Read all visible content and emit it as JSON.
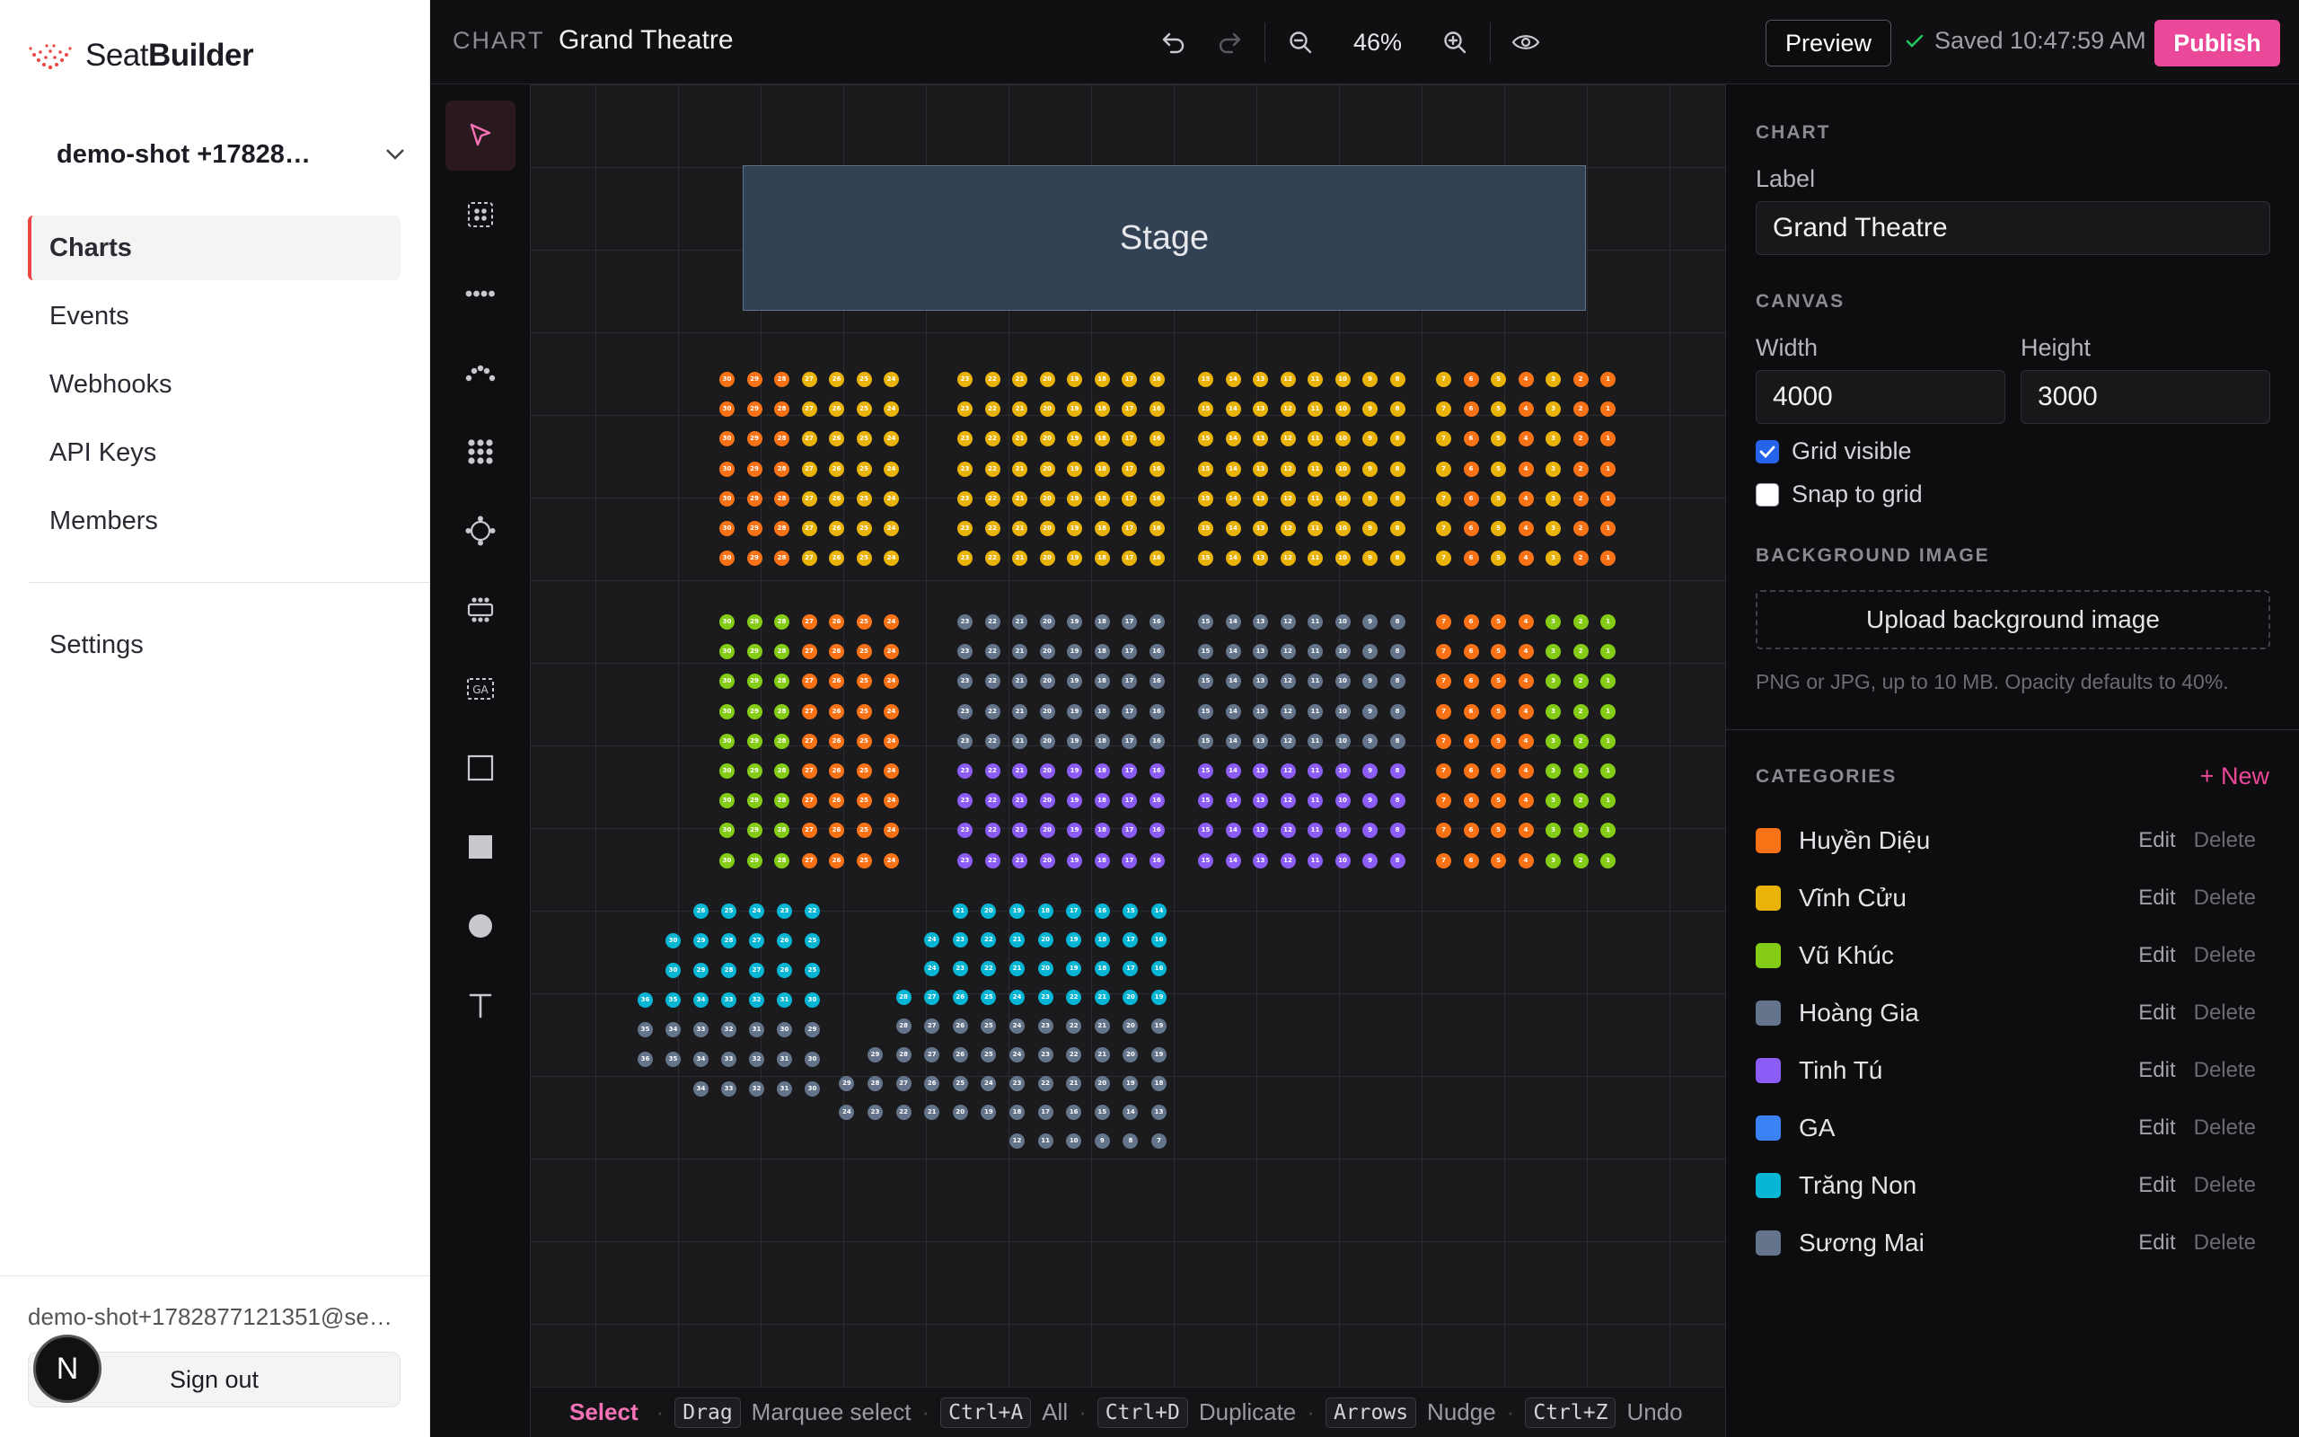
{
  "brand": {
    "name_light": "Seat",
    "name_bold": "Builder"
  },
  "org": {
    "name": "demo-shot +17828…"
  },
  "nav": [
    {
      "label": "Charts",
      "active": true
    },
    {
      "label": "Events"
    },
    {
      "label": "Webhooks"
    },
    {
      "label": "API Keys"
    },
    {
      "label": "Members"
    }
  ],
  "nav_settings": "Settings",
  "account": {
    "email": "demo-shot+1782877121351@seat…",
    "signout": "Sign out",
    "avatar_letter": "N"
  },
  "topbar": {
    "crumb": "CHART",
    "title": "Grand Theatre",
    "zoom": "46%",
    "preview": "Preview",
    "saved": "Saved 10:47:59 AM",
    "publish": "Publish"
  },
  "tools": [
    "select-tool",
    "section-tool",
    "row-tool",
    "curved-row-tool",
    "grid-tool",
    "round-table-tool",
    "rect-table-tool",
    "ga-area-tool",
    "rectangle-tool",
    "filled-rectangle-tool",
    "circle-tool",
    "text-tool"
  ],
  "canvas": {
    "stage_label": "Stage"
  },
  "shortcuts": {
    "mode": "Select",
    "items": [
      {
        "key": "Drag",
        "desc": "Marquee select"
      },
      {
        "key": "Ctrl+A",
        "desc": "All"
      },
      {
        "key": "Ctrl+D",
        "desc": "Duplicate"
      },
      {
        "key": "Arrows",
        "desc": "Nudge"
      },
      {
        "key": "Ctrl+Z",
        "desc": "Undo"
      }
    ]
  },
  "inspector": {
    "chart_section": "CHART",
    "label_field": "Label",
    "label_value": "Grand Theatre",
    "canvas_section": "CANVAS",
    "width_label": "Width",
    "width_value": "4000",
    "height_label": "Height",
    "height_value": "3000",
    "grid_visible_label": "Grid visible",
    "grid_visible": true,
    "snap_label": "Snap to grid",
    "snap": false,
    "bg_section": "BACKGROUND IMAGE",
    "upload_label": "Upload background image",
    "upload_hint": "PNG or JPG, up to 10 MB. Opacity defaults to 40%.",
    "categories_section": "CATEGORIES",
    "new_label": "+ New",
    "edit_label": "Edit",
    "delete_label": "Delete"
  },
  "categories": [
    {
      "name": "Huyền Diệu",
      "color": "#f97316"
    },
    {
      "name": "Vĩnh Cửu",
      "color": "#eab308"
    },
    {
      "name": "Vũ Khúc",
      "color": "#84cc16"
    },
    {
      "name": "Hoàng Gia",
      "color": "#64748b"
    },
    {
      "name": "Tinh Tú",
      "color": "#8b5cf6"
    },
    {
      "name": "GA",
      "color": "#3b82f6"
    },
    {
      "name": "Trăng Non",
      "color": "#06b6d4"
    },
    {
      "name": "Sương Mai",
      "color": "#64748b"
    }
  ],
  "seat_blocks": [
    {
      "name": "block-a-top",
      "cols": [
        30,
        29,
        28,
        27,
        26,
        25,
        24
      ],
      "rows": 7,
      "colors": [
        "#f97316",
        "#f97316",
        "#f97316",
        "#eab308",
        "#eab308",
        "#eab308",
        "#eab308"
      ]
    },
    {
      "name": "block-b-top",
      "cols": [
        23,
        22,
        21,
        20,
        19,
        18,
        17,
        16
      ],
      "rows": 7,
      "colors": [
        "#eab308"
      ]
    },
    {
      "name": "block-c-top",
      "cols": [
        15,
        14,
        13,
        12,
        11,
        10,
        9,
        8
      ],
      "rows": 7,
      "colors": [
        "#eab308"
      ]
    },
    {
      "name": "block-d-top",
      "cols": [
        7,
        6,
        5,
        4,
        3,
        2,
        1
      ],
      "rows": 7,
      "colors": [
        "#eab308",
        "#f97316",
        "#eab308",
        "#f97316",
        "#eab308",
        "#f97316",
        "#f97316"
      ]
    },
    {
      "name": "block-a-mid",
      "cols": [
        30,
        29,
        28,
        27,
        26,
        25,
        24
      ],
      "rows": 9,
      "colors": [
        "#84cc16",
        "#84cc16",
        "#84cc16",
        "#f97316",
        "#f97316",
        "#f97316",
        "#f97316"
      ]
    },
    {
      "name": "block-b-mid",
      "cols": [
        23,
        22,
        21,
        20,
        19,
        18,
        17,
        16
      ],
      "rows": 9,
      "colors": [
        "#64748b"
      ],
      "accent_rows_from": 5,
      "accent": "#8b5cf6"
    },
    {
      "name": "block-c-mid",
      "cols": [
        15,
        14,
        13,
        12,
        11,
        10,
        9,
        8
      ],
      "rows": 9,
      "colors": [
        "#64748b"
      ],
      "accent_rows_from": 5,
      "accent": "#8b5cf6"
    },
    {
      "name": "block-d-mid",
      "cols": [
        7,
        6,
        5,
        4,
        3,
        2,
        1
      ],
      "rows": 9,
      "colors": [
        "#f97316",
        "#f97316",
        "#f97316",
        "#f97316",
        "#84cc16",
        "#84cc16",
        "#84cc16"
      ]
    }
  ],
  "balcony_rows": [
    {
      "labels": [
        26,
        25,
        24,
        23,
        22
      ],
      "color": "#06b6d4"
    },
    {
      "labels": [
        30,
        29,
        28,
        27,
        26,
        25
      ],
      "color": "#06b6d4"
    },
    {
      "labels": [
        30,
        29,
        28,
        27,
        26,
        25
      ],
      "color": "#06b6d4"
    },
    {
      "labels": [
        36,
        35,
        34,
        33,
        32,
        31,
        30
      ],
      "color": "#06b6d4"
    },
    {
      "labels": [
        35,
        34,
        33,
        32,
        31,
        30,
        29
      ],
      "color": "#64748b"
    },
    {
      "labels": [
        36,
        35,
        34,
        33,
        32,
        31,
        30
      ],
      "color": "#64748b"
    },
    {
      "labels": [
        34,
        33,
        32,
        31,
        30
      ],
      "color": "#64748b"
    }
  ],
  "balcony_right_rows": [
    {
      "labels": [
        21,
        20,
        19,
        18,
        17,
        16,
        15,
        14
      ],
      "color": "#06b6d4"
    },
    {
      "labels": [
        24,
        23,
        22,
        21,
        20,
        19,
        18,
        17,
        16
      ],
      "color": "#06b6d4"
    },
    {
      "labels": [
        24,
        23,
        22,
        21,
        20,
        19,
        18,
        17,
        16
      ],
      "color": "#06b6d4"
    },
    {
      "labels": [
        28,
        27,
        26,
        25,
        24,
        23,
        22,
        21,
        20,
        19
      ],
      "color": "#06b6d4"
    },
    {
      "labels": [
        28,
        27,
        26,
        25,
        24,
        23,
        22,
        21,
        20,
        19
      ],
      "color": "#64748b"
    },
    {
      "labels": [
        29,
        28,
        27,
        26,
        25,
        24,
        23,
        22,
        21,
        20,
        19
      ],
      "color": "#64748b"
    },
    {
      "labels": [
        29,
        28,
        27,
        26,
        25,
        24,
        23,
        22,
        21,
        20,
        19,
        18
      ],
      "color": "#64748b"
    },
    {
      "labels": [
        24,
        23,
        22,
        21,
        20,
        19,
        18,
        17,
        16,
        15,
        14,
        13
      ],
      "color": "#64748b"
    },
    {
      "labels": [
        12,
        11,
        10,
        9,
        8,
        7
      ],
      "color": "#64748b"
    }
  ]
}
